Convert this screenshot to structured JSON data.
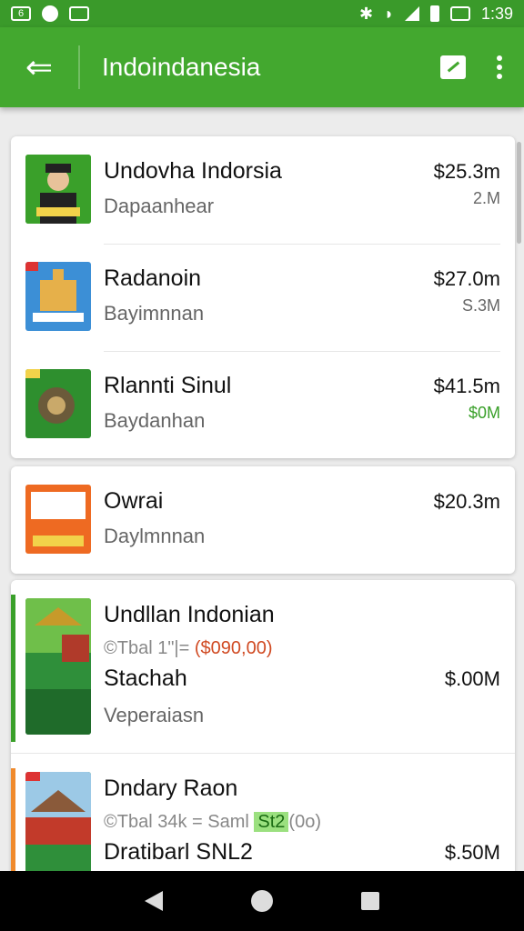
{
  "status_bar": {
    "left_icons": [
      "sim-icon",
      "notification-icon",
      "mail-icon"
    ],
    "sim_label": "6",
    "time": "1:39"
  },
  "app_bar": {
    "title": "Indoindanesia",
    "back_glyph": "⇐"
  },
  "colors": {
    "primary": "#43a82f",
    "status": "#3a9a2a",
    "accent_orange": "#f08a2c"
  },
  "group1": [
    {
      "name": "Undovha Indorsia",
      "sub": "Dapaanhear",
      "price": "$25.3m",
      "vol": "2.M",
      "thumb_color": "#3aa02a"
    },
    {
      "name": "Radanoin",
      "sub": "Bayimnnan",
      "price": "$27.0m",
      "vol": "S.3M",
      "thumb_color": "#3c8fd6"
    },
    {
      "name": "Rlannti Sinul",
      "sub": "Baydanhan",
      "price": "$41.5m",
      "vol": "$0M",
      "vol_color": "#3aa02a",
      "thumb_color": "#2e8f2e"
    }
  ],
  "group2": [
    {
      "name": "Owrai",
      "sub": "Daylmnnan",
      "price": "$20.3m",
      "vol": "",
      "thumb_color": "#ee6a22"
    }
  ],
  "group3": [
    {
      "name": "Undllan Indonian",
      "meta_prefix": "©Tbal 1\"|= ",
      "meta_value": "($090,00)",
      "name2": "Stachah",
      "sub2": "Veperaiasn",
      "price": "$.00M",
      "accent": "#3aa02a",
      "thumb_color": "#2f8f3a"
    },
    {
      "name": "Dndary Raon",
      "meta_prefix": "©Tbal 34k = Saml ",
      "meta_chip": "St2",
      "meta_suffix": "(0o)",
      "name2": "Dratibarl SNL2",
      "price": "$.50M",
      "accent": "#f08a2c",
      "thumb_color": "#2f8f3a"
    }
  ]
}
